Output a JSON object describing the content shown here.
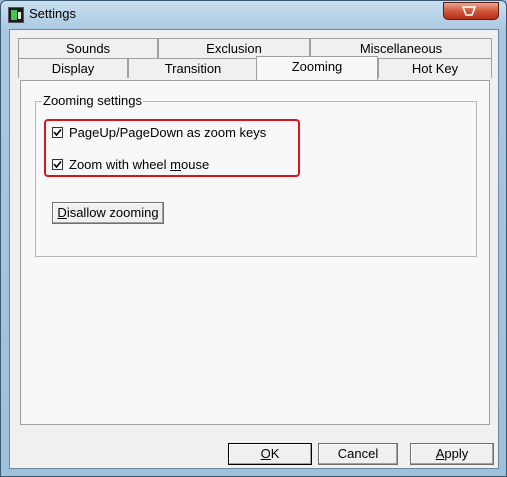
{
  "window": {
    "title": "Settings"
  },
  "tabs_row_back": [
    {
      "label": "Sounds"
    },
    {
      "label": "Exclusion"
    },
    {
      "label": "Miscellaneous"
    }
  ],
  "tabs_row_front": [
    {
      "label": "Display"
    },
    {
      "label": "Transition"
    },
    {
      "label": "Zooming"
    },
    {
      "label": "Hot Key"
    }
  ],
  "zooming": {
    "group_title": "Zooming settings",
    "pageupdown_prefix": "PageUp/PageDown as zoom keys",
    "pageupdown_checked": true,
    "wheel_prefix": "Zoom with wheel ",
    "wheel_underline": "m",
    "wheel_suffix": "ouse",
    "wheel_checked": true,
    "disallow_underline": "D",
    "disallow_suffix": "isallow zooming"
  },
  "buttons": {
    "ok_underline": "O",
    "ok_suffix": "K",
    "cancel": "Cancel",
    "apply_underline": "A",
    "apply_suffix": "pply"
  },
  "colors": {
    "highlight": "#d8141f",
    "close_button": "#c9452b"
  }
}
